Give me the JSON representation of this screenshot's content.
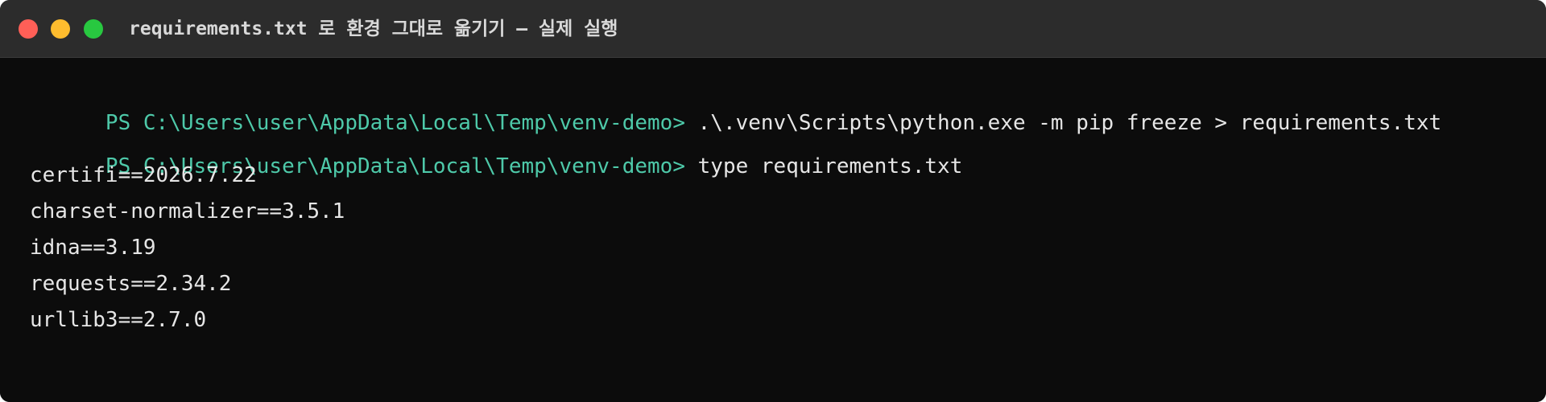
{
  "window": {
    "title": "requirements.txt 로 환경 그대로 옮기기 — 실제 실행",
    "controls": {
      "close_color": "#ff5f57",
      "minimize_color": "#febc2e",
      "maximize_color": "#28c840"
    }
  },
  "terminal": {
    "prompt_color": "#4ec9a9",
    "lines": [
      {
        "prompt": "PS C:\\Users\\user\\AppData\\Local\\Temp\\venv-demo>",
        "command": " .\\.venv\\Scripts\\python.exe -m pip freeze > requirements.txt"
      },
      {
        "prompt": "PS C:\\Users\\user\\AppData\\Local\\Temp\\venv-demo>",
        "command": " type requirements.txt"
      }
    ],
    "output": [
      "certifi==2026.7.22",
      "charset-normalizer==3.5.1",
      "idna==3.19",
      "requests==2.34.2",
      "urllib3==2.7.0"
    ]
  }
}
